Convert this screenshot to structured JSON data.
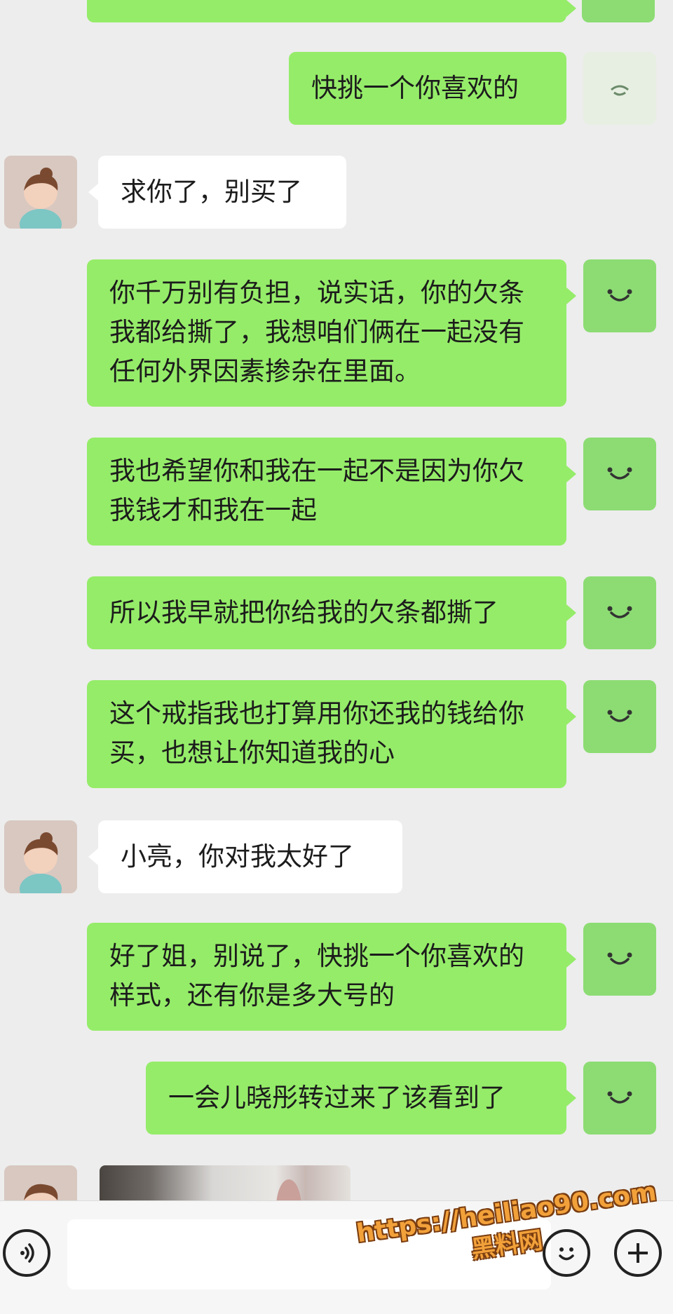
{
  "chat": {
    "messages": [
      {
        "from": "me",
        "text": "快挑一个你喜欢的"
      },
      {
        "from": "her",
        "text": "求你了，别买了"
      },
      {
        "from": "me",
        "text": "你千万别有负担，说实话，你的欠条我都给撕了，我想咱们俩在一起没有任何外界因素掺杂在里面。"
      },
      {
        "from": "me",
        "text": "我也希望你和我在一起不是因为你欠我钱才和我在一起"
      },
      {
        "from": "me",
        "text": "所以我早就把你给我的欠条都撕了"
      },
      {
        "from": "me",
        "text": "这个戒指我也打算用你还我的钱给你买，也想让你知道我的心"
      },
      {
        "from": "her",
        "text": "小亮，你对我太好了"
      },
      {
        "from": "me",
        "text": "好了姐，别说了，快挑一个你喜欢的样式，还有你是多大号的"
      },
      {
        "from": "me",
        "text": "一会儿晓彤转过来了该看到了"
      }
    ]
  },
  "composer": {
    "voice_icon": "voice-icon",
    "emoji_icon": "emoji-icon",
    "plus_icon": "plus-icon",
    "input_value": ""
  },
  "watermark": {
    "url": "https://heiliao90.com",
    "site": "黑料网"
  },
  "colors": {
    "sent_bubble": "#95ec69",
    "received_bubble": "#ffffff",
    "background": "#ededed",
    "watermark": "#f2a13a"
  }
}
